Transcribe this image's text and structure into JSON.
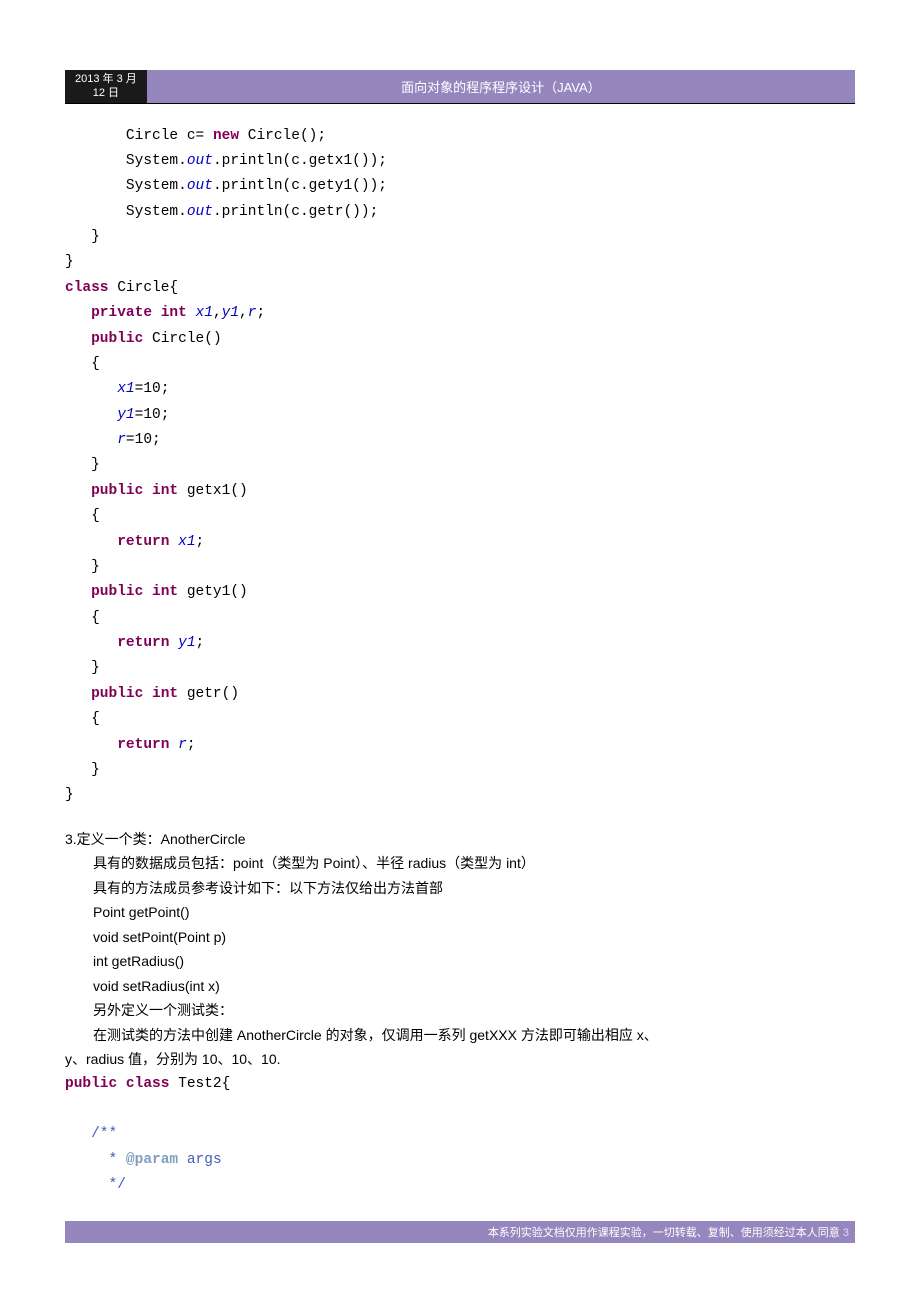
{
  "header": {
    "date_line1": "2013 年 3 月",
    "date_line2": "12 日",
    "title": "面向对象的程序程序设计（JAVA）"
  },
  "code1": {
    "l1a": "       Circle c= ",
    "l1kw": "new",
    "l1b": " Circle();",
    "l2a": "       System.",
    "l2f": "out",
    "l2b": ".println(c.getx1());",
    "l3a": "       System.",
    "l3f": "out",
    "l3b": ".println(c.gety1());",
    "l4a": "       System.",
    "l4f": "out",
    "l4b": ".println(c.getr());",
    "l5": "   }",
    "l6": "}",
    "l7kw": "class",
    "l7b": " Circle{",
    "l8a": "   ",
    "l8kw": "private int",
    "l8b": " ",
    "l8f": "x1",
    "l8c": ",",
    "l8f2": "y1",
    "l8d": ",",
    "l8f3": "r",
    "l8e": ";",
    "l9a": "   ",
    "l9kw": "public",
    "l9b": " Circle()",
    "l10": "   {",
    "l11a": "      ",
    "l11f": "x1",
    "l11b": "=10;",
    "l12a": "      ",
    "l12f": "y1",
    "l12b": "=10;",
    "l13a": "      ",
    "l13f": "r",
    "l13b": "=10;",
    "l14": "   }",
    "l15a": "   ",
    "l15kw": "public int",
    "l15b": " getx1()",
    "l16": "   {",
    "l17a": "      ",
    "l17kw": "return",
    "l17b": " ",
    "l17f": "x1",
    "l17c": ";",
    "l18": "   }",
    "l19a": "   ",
    "l19kw": "public int",
    "l19b": " gety1()",
    "l20": "   {",
    "l21a": "      ",
    "l21kw": "return",
    "l21b": " ",
    "l21f": "y1",
    "l21c": ";",
    "l22": "   }",
    "l23a": "   ",
    "l23kw": "public int",
    "l23b": " getr()",
    "l24": "   {",
    "l25a": "      ",
    "l25kw": "return",
    "l25b": " ",
    "l25f": "r",
    "l25c": ";",
    "l26": "   }",
    "l27": "}"
  },
  "text": {
    "p1": "3.定义一个类：AnotherCircle",
    "p2": "具有的数据成员包括：point（类型为 Point）、半径 radius（类型为 int）",
    "p3": "具有的方法成员参考设计如下：以下方法仅给出方法首部",
    "p4": "Point getPoint()",
    "p5": "void setPoint(Point p)",
    "p6": "int getRadius()",
    "p7": "void setRadius(int x)",
    "p8": "另外定义一个测试类：",
    "p9a": "在测试类的方法中创建 AnotherCircle 的对象，仅调用一系列 getXXX 方法即可输出相应 x、",
    "p9b": "y、radius 值，分别为 10、10、10."
  },
  "code2": {
    "l1kw": "public class",
    "l1b": " Test2{",
    "l2": "",
    "l3a": "   ",
    "l3c": "/**",
    "l4a": "    ",
    "l4c1": " * ",
    "l4c2": "@param",
    "l4c3": " args",
    "l5a": "    ",
    "l5c": " */"
  },
  "footer": {
    "text": "本系列实验文档仅用作课程实验，一切转载、复制、使用须经过本人同意",
    "page": " 3"
  }
}
